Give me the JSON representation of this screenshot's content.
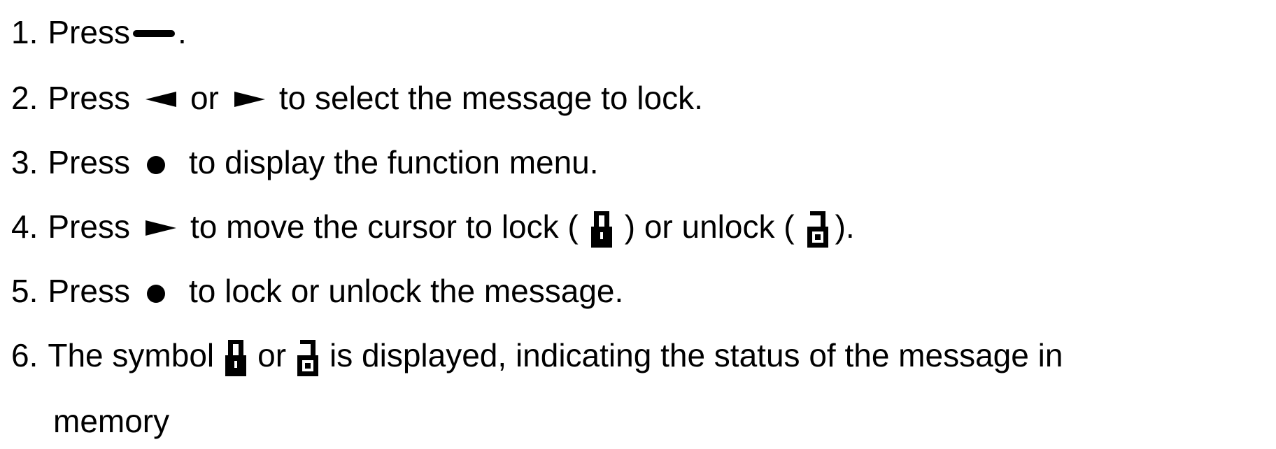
{
  "steps": [
    {
      "number": "1.",
      "parts": [
        "Press",
        "."
      ]
    },
    {
      "number": "2.",
      "parts": [
        "Press",
        "or",
        "to select the message to lock."
      ]
    },
    {
      "number": "3.",
      "parts": [
        "Press",
        "to display the function menu."
      ]
    },
    {
      "number": "4.",
      "parts": [
        "Press",
        "to move the cursor to lock (",
        ") or unlock (",
        ")."
      ]
    },
    {
      "number": "5.",
      "parts": [
        "Press",
        "to lock or unlock the message."
      ]
    },
    {
      "number": "6.",
      "parts": [
        "The symbol",
        "or",
        "is displayed, indicating the status of the message in",
        "memory"
      ]
    }
  ],
  "icons": {
    "dash": "minus-button-icon",
    "left": "left-arrow-icon",
    "right": "right-arrow-icon",
    "dot": "center-button-icon",
    "lock": "lock-icon",
    "unlock": "unlock-icon"
  }
}
